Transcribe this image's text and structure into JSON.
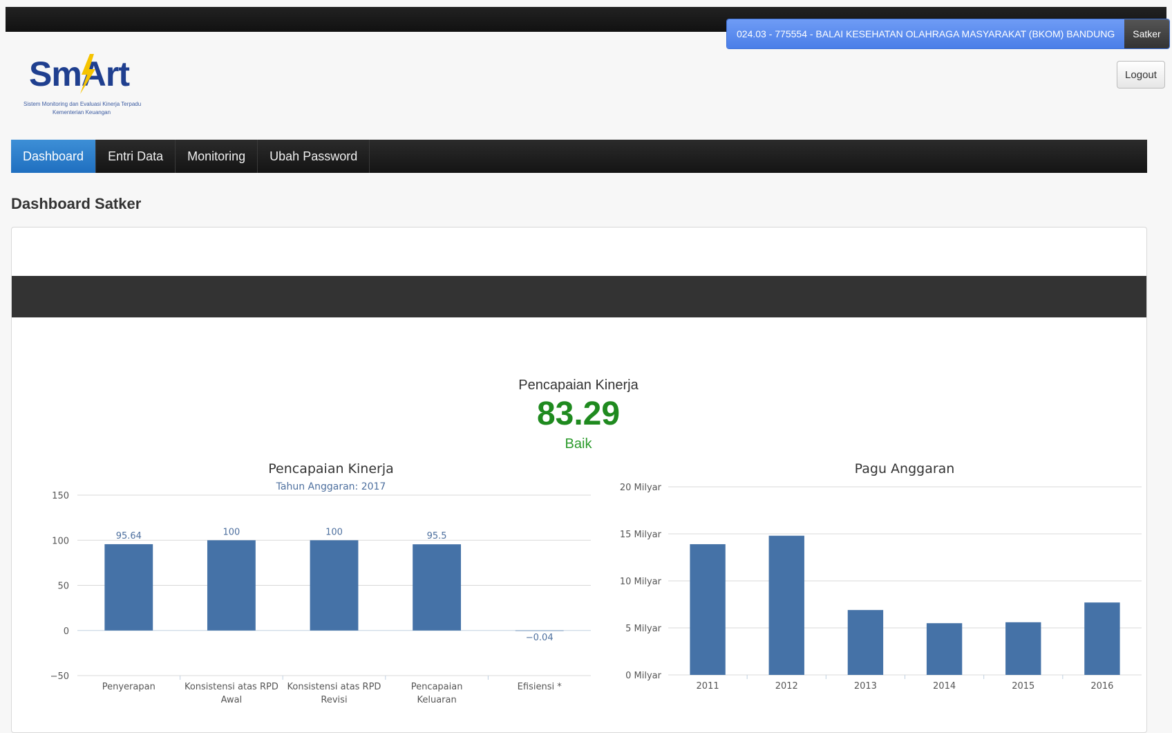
{
  "header": {
    "satker_name": "024.03 - 775554 - BALAI KESEHATAN OLAHRAGA MASYARAKAT (BKOM) BANDUNG",
    "role": "Satker",
    "logout_label": "Logout"
  },
  "logo": {
    "title": "SmArt",
    "subtitle_1": "Sistem Monitoring dan Evaluasi Kinerja Terpadu",
    "subtitle_2": "Kementerian Keuangan"
  },
  "nav": {
    "items": [
      {
        "label": "Dashboard",
        "active": true
      },
      {
        "label": "Entri Data",
        "active": false
      },
      {
        "label": "Monitoring",
        "active": false
      },
      {
        "label": "Ubah Password",
        "active": false
      }
    ]
  },
  "page": {
    "title": "Dashboard Satker"
  },
  "kpi": {
    "label": "Pencapaian Kinerja",
    "value": "83.29",
    "status": "Baik"
  },
  "colors": {
    "bar": "#4572a7",
    "kpi_value": "#1f8a1f",
    "nav_active": "#2a7cc8"
  },
  "chart_data": [
    {
      "type": "bar",
      "title": "Pencapaian Kinerja",
      "subtitle": "Tahun Anggaran: 2017",
      "categories": [
        "Penyerapan",
        "Konsistensi atas RPD Awal",
        "Konsistensi atas RPD Revisi",
        "Pencapaian Keluaran",
        "Efisiensi *"
      ],
      "values": [
        95.64,
        100,
        100,
        95.5,
        -0.04
      ],
      "data_labels": [
        "95.64",
        "100",
        "100",
        "95.5",
        "−0.04"
      ],
      "ylim": [
        -50,
        150
      ],
      "yticks": [
        150,
        100,
        50,
        0,
        -50
      ],
      "ytick_labels": [
        "150",
        "100",
        "50",
        "0",
        "−50"
      ],
      "grid": true
    },
    {
      "type": "bar",
      "title": "Pagu Anggaran",
      "categories": [
        "2011",
        "2012",
        "2013",
        "2014",
        "2015",
        "2016"
      ],
      "values": [
        13.9,
        14.8,
        6.9,
        5.5,
        5.6,
        7.7
      ],
      "ylim": [
        0,
        20
      ],
      "yticks": [
        20,
        15,
        10,
        5,
        0
      ],
      "ytick_labels": [
        "20 Milyar",
        "15 Milyar",
        "10 Milyar",
        "5 Milyar",
        "0 Milyar"
      ],
      "grid": true
    }
  ]
}
